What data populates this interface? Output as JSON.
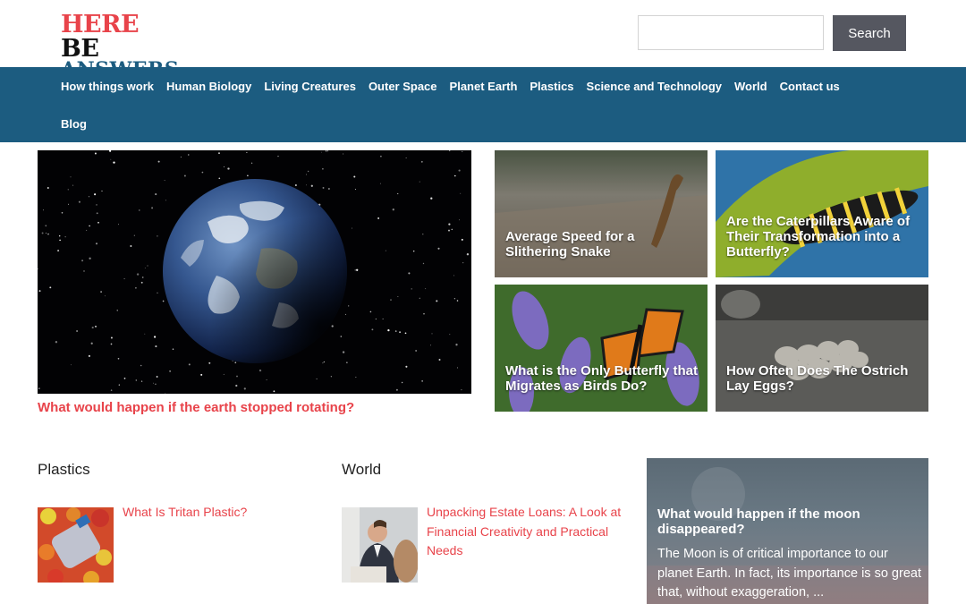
{
  "header": {
    "logo_line1_here": "HERE",
    "logo_line1_be": "BE",
    "logo_line2": "ANSWERS",
    "search_value": "",
    "search_button": "Search"
  },
  "nav": {
    "items": [
      {
        "label": "How things work"
      },
      {
        "label": "Human Biology"
      },
      {
        "label": "Living Creatures"
      },
      {
        "label": "Outer Space"
      },
      {
        "label": "Planet Earth"
      },
      {
        "label": "Plastics"
      },
      {
        "label": "Science and Technology"
      },
      {
        "label": "World"
      },
      {
        "label": "Contact us"
      },
      {
        "label": "Blog"
      }
    ]
  },
  "featured": {
    "main_title": "What would happen if the earth stopped rotating?",
    "tiles": [
      {
        "title": "Average Speed for a Slithering Snake"
      },
      {
        "title": "Are the Caterpillars Aware of Their Transformation into a Butterfly?"
      },
      {
        "title": "What is the Only Butterfly that Migrates as Birds Do?"
      },
      {
        "title": "How Often Does The Ostrich Lay Eggs?"
      }
    ]
  },
  "sections": {
    "plastics": {
      "title": "Plastics",
      "post_title": "What Is Tritan Plastic?"
    },
    "world": {
      "title": "World",
      "post_title": "Unpacking Estate Loans: A Look at Financial Creativity and Practical Needs"
    },
    "moon_card": {
      "title": "What would happen if the moon disappeared?",
      "excerpt": "The Moon is of critical importance to our planet Earth. In fact, its importance is so great that, without exaggeration, ..."
    }
  },
  "colors": {
    "brand_red": "#e8434a",
    "nav_blue": "#1c5c80",
    "search_button": "#555760"
  }
}
